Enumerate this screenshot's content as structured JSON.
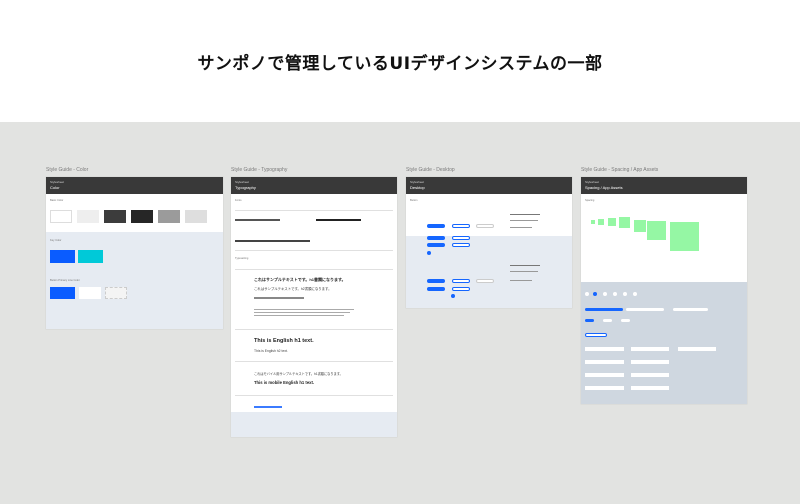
{
  "page": {
    "title": "サンポノで管理しているUIデザインシステムの一部"
  },
  "frames": {
    "color": {
      "label": "Style Guide - Color",
      "header_sub": "Stylesheet",
      "header_title": "Color",
      "section_basic": "Basic Color",
      "section_key": "Key Color",
      "section_button": "Button Primary Line Color",
      "accent": "#0a5cff",
      "cyan": "#00c9d8"
    },
    "typography": {
      "label": "Style Guide - Typography",
      "header_sub": "Stylesheet",
      "header_title": "Typography",
      "section_font": "Fonts",
      "section_typeset": "Typesetting",
      "jp_h1": "これはサンプルテキストです。h1書類になります。",
      "jp_h2": "これはサンプルテキストです。h2書類になります。",
      "en_h1": "This is English h1 text.",
      "en_h2": "This is English h2 text.",
      "mobile_jp": "これはモバイル用サンプルテキストです。h1書類になります。",
      "mobile_en": "This is mobile English h1 text."
    },
    "desktop": {
      "label": "Style Guide - Desktop",
      "header_sub": "Stylesheet",
      "header_title": "Desktop",
      "section_button": "Button"
    },
    "spacing": {
      "label": "Style Guide - Spacing / App Assets",
      "header_sub": "Stylesheet",
      "header_title": "Spacing / App Assets",
      "section_spacing": "Spacing",
      "green": "#95f7a4"
    }
  }
}
